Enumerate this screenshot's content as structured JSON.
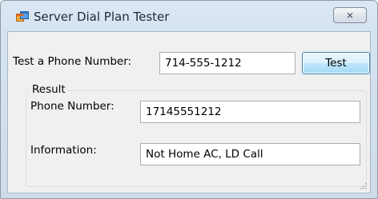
{
  "window": {
    "title": "Server Dial Plan Tester",
    "close_glyph": "⨯",
    "icon": "app-window-icon"
  },
  "test": {
    "label": "Test a Phone Number:",
    "value": "714-555-1212",
    "button_label": "Test"
  },
  "result": {
    "group_label": "Result",
    "phone_label": "Phone Number:",
    "phone_value": "17145551212",
    "info_label": "Information:",
    "info_value": "Not Home AC, LD Call"
  },
  "colors": {
    "titlebar": "#dce7f3",
    "client": "#f0f0f0",
    "button_border": "#3c7fb1"
  }
}
